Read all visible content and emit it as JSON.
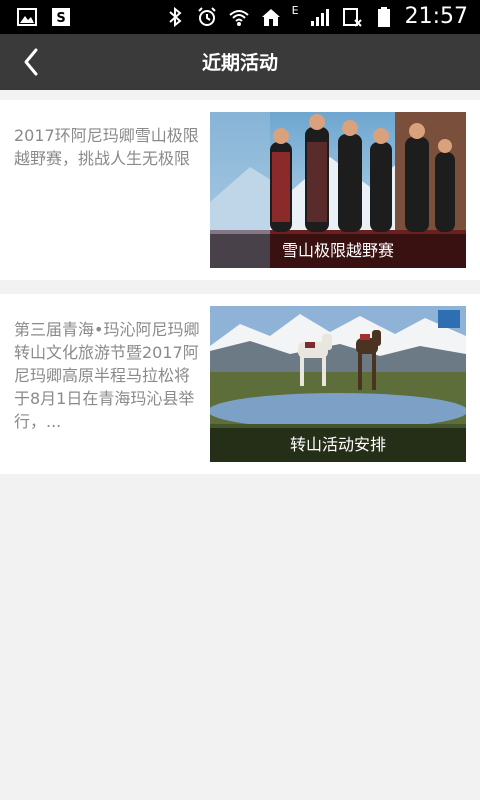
{
  "status_bar": {
    "time": "21:57",
    "network": "E"
  },
  "header": {
    "title": "近期活动",
    "back_icon": "chevron-left-icon"
  },
  "events": [
    {
      "text": "2017环阿尼玛卿雪山极限越野赛，挑战人生无极限",
      "image_caption": "雪山极限越野赛"
    },
    {
      "text": "第三届青海•玛沁阿尼玛卿转山文化旅游节暨2017阿尼玛卿高原半程马拉松将于8月1日在青海玛沁县举行，...",
      "image_caption": "转山活动安排"
    }
  ]
}
